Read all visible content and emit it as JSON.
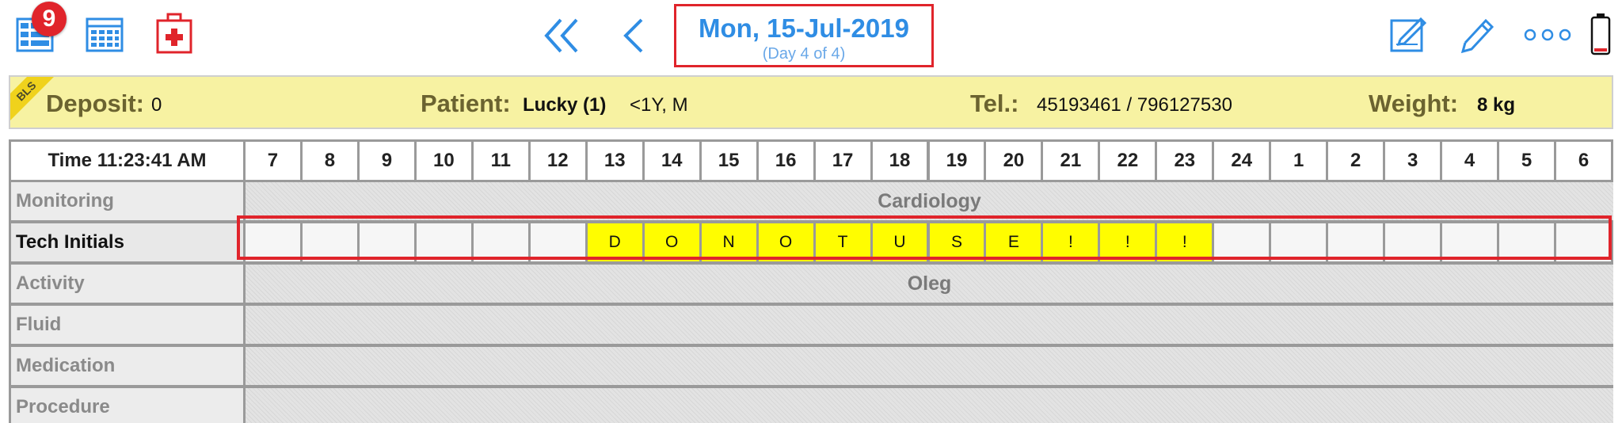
{
  "toolbar": {
    "left_icons": [
      "list-view-icon",
      "calendar-grid-icon",
      "medical-kit-icon"
    ],
    "badge_count": "9",
    "nav_icons": [
      "double-chevron-left-icon",
      "chevron-left-icon"
    ],
    "right_icons": [
      "edit-note-icon",
      "pencil-icon",
      "more-icon",
      "battery-icon"
    ],
    "date": "Mon, 15-Jul-2019",
    "day_of": "(Day 4 of 4)",
    "accent_color": "#2f8de4",
    "highlight_color": "#e0242b"
  },
  "banner": {
    "corner_tag": "BLS",
    "deposit_label": "Deposit:",
    "deposit_value": "0",
    "patient_label": "Patient:",
    "patient_name": "Lucky (1)",
    "patient_info": "<1Y,  M",
    "tel_label": "Tel.:",
    "tel_value": "45193461 / 796127530",
    "weight_label": "Weight:",
    "weight_value": "8 kg",
    "background_color": "#f7f2a2"
  },
  "grid": {
    "time_header": "Time 11:23:41 AM",
    "hours": [
      "7",
      "8",
      "9",
      "10",
      "11",
      "12",
      "13",
      "14",
      "15",
      "16",
      "17",
      "18",
      "19",
      "20",
      "21",
      "22",
      "23",
      "24",
      "1",
      "2",
      "3",
      "4",
      "5",
      "6"
    ],
    "rows": [
      {
        "label": "Monitoring",
        "content": "Cardiology"
      },
      {
        "label": "Tech Initials",
        "cells": [
          "",
          "",
          "",
          "",
          "",
          "",
          "D",
          "O",
          "N",
          "O",
          "T",
          "U",
          "S",
          "E",
          "!",
          "!",
          "!",
          "",
          "",
          "",
          "",
          "",
          "",
          ""
        ]
      },
      {
        "label": "Activity",
        "content": "Oleg"
      },
      {
        "label": "Fluid",
        "content": ""
      },
      {
        "label": "Medication",
        "content": ""
      },
      {
        "label": "Procedure",
        "content": ""
      }
    ],
    "tech_highlight_color": "#fffd00"
  }
}
